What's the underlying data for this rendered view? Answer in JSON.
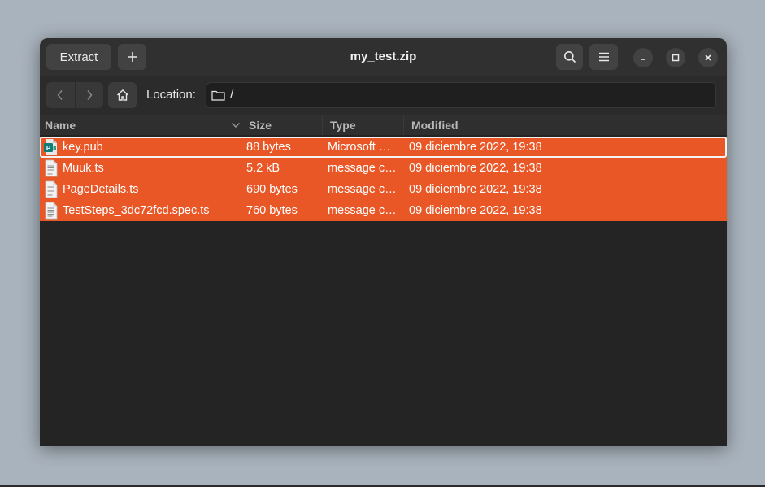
{
  "window": {
    "title": "my_test.zip"
  },
  "headerbar": {
    "extract_label": "Extract",
    "add_icon": "plus-icon",
    "search_icon": "search-icon",
    "menu_icon": "hamburger-menu-icon"
  },
  "location": {
    "label": "Location:",
    "path": "/"
  },
  "columns": {
    "name": "Name",
    "size": "Size",
    "type": "Type",
    "modified": "Modified"
  },
  "files": [
    {
      "name": "key.pub",
      "size": "88 bytes",
      "type": "Microsoft …",
      "modified": "09 diciembre 2022, 19:38",
      "icon": "publisher-document-icon"
    },
    {
      "name": "Muuk.ts",
      "size": "5.2 kB",
      "type": "message ca…",
      "modified": "09 diciembre 2022, 19:38",
      "icon": "text-document-icon"
    },
    {
      "name": "PageDetails.ts",
      "size": "690 bytes",
      "type": "message ca…",
      "modified": "09 diciembre 2022, 19:38",
      "icon": "text-document-icon"
    },
    {
      "name": "TestSteps_3dc72fcd.spec.ts",
      "size": "760 bytes",
      "type": "message ca…",
      "modified": "09 diciembre 2022, 19:38",
      "icon": "text-document-icon"
    }
  ],
  "colors": {
    "selection": "#ea5727",
    "window_bg": "#242424",
    "desktop": "#a9b3bd"
  }
}
